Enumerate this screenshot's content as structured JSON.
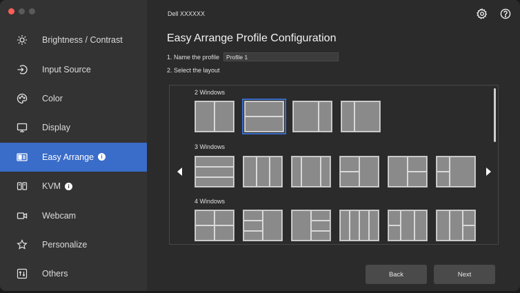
{
  "window": {
    "title": "Dell XXXXXX",
    "traffic_colors": [
      "#ff5f57",
      "#5a5a5a",
      "#5a5a5a"
    ]
  },
  "sidebar": {
    "items": [
      {
        "label": "Brightness / Contrast",
        "icon": "brightness-icon",
        "active": false,
        "info": false
      },
      {
        "label": "Input Source",
        "icon": "input-source-icon",
        "active": false,
        "info": false
      },
      {
        "label": "Color",
        "icon": "color-palette-icon",
        "active": false,
        "info": false
      },
      {
        "label": "Display",
        "icon": "display-icon",
        "active": false,
        "info": false
      },
      {
        "label": "Easy Arrange",
        "icon": "easy-arrange-icon",
        "active": true,
        "info": true
      },
      {
        "label": "KVM",
        "icon": "kvm-icon",
        "active": false,
        "info": true
      },
      {
        "label": "Webcam",
        "icon": "webcam-icon",
        "active": false,
        "info": false
      },
      {
        "label": "Personalize",
        "icon": "star-icon",
        "active": false,
        "info": false
      },
      {
        "label": "Others",
        "icon": "others-icon",
        "active": false,
        "info": false
      }
    ],
    "accent_color": "#3a6cc9"
  },
  "main": {
    "title": "Easy Arrange Profile Configuration",
    "step1_label": "1. Name the profile",
    "profile_name": "Profile 1",
    "step2_label": "2. Select the layout",
    "groups": [
      {
        "label": "2 Windows"
      },
      {
        "label": "3 Windows"
      },
      {
        "label": "4 Windows"
      }
    ],
    "selected_layout": "2 Windows, layout 2 (top/bottom split)",
    "back_label": "Back",
    "next_label": "Next"
  }
}
